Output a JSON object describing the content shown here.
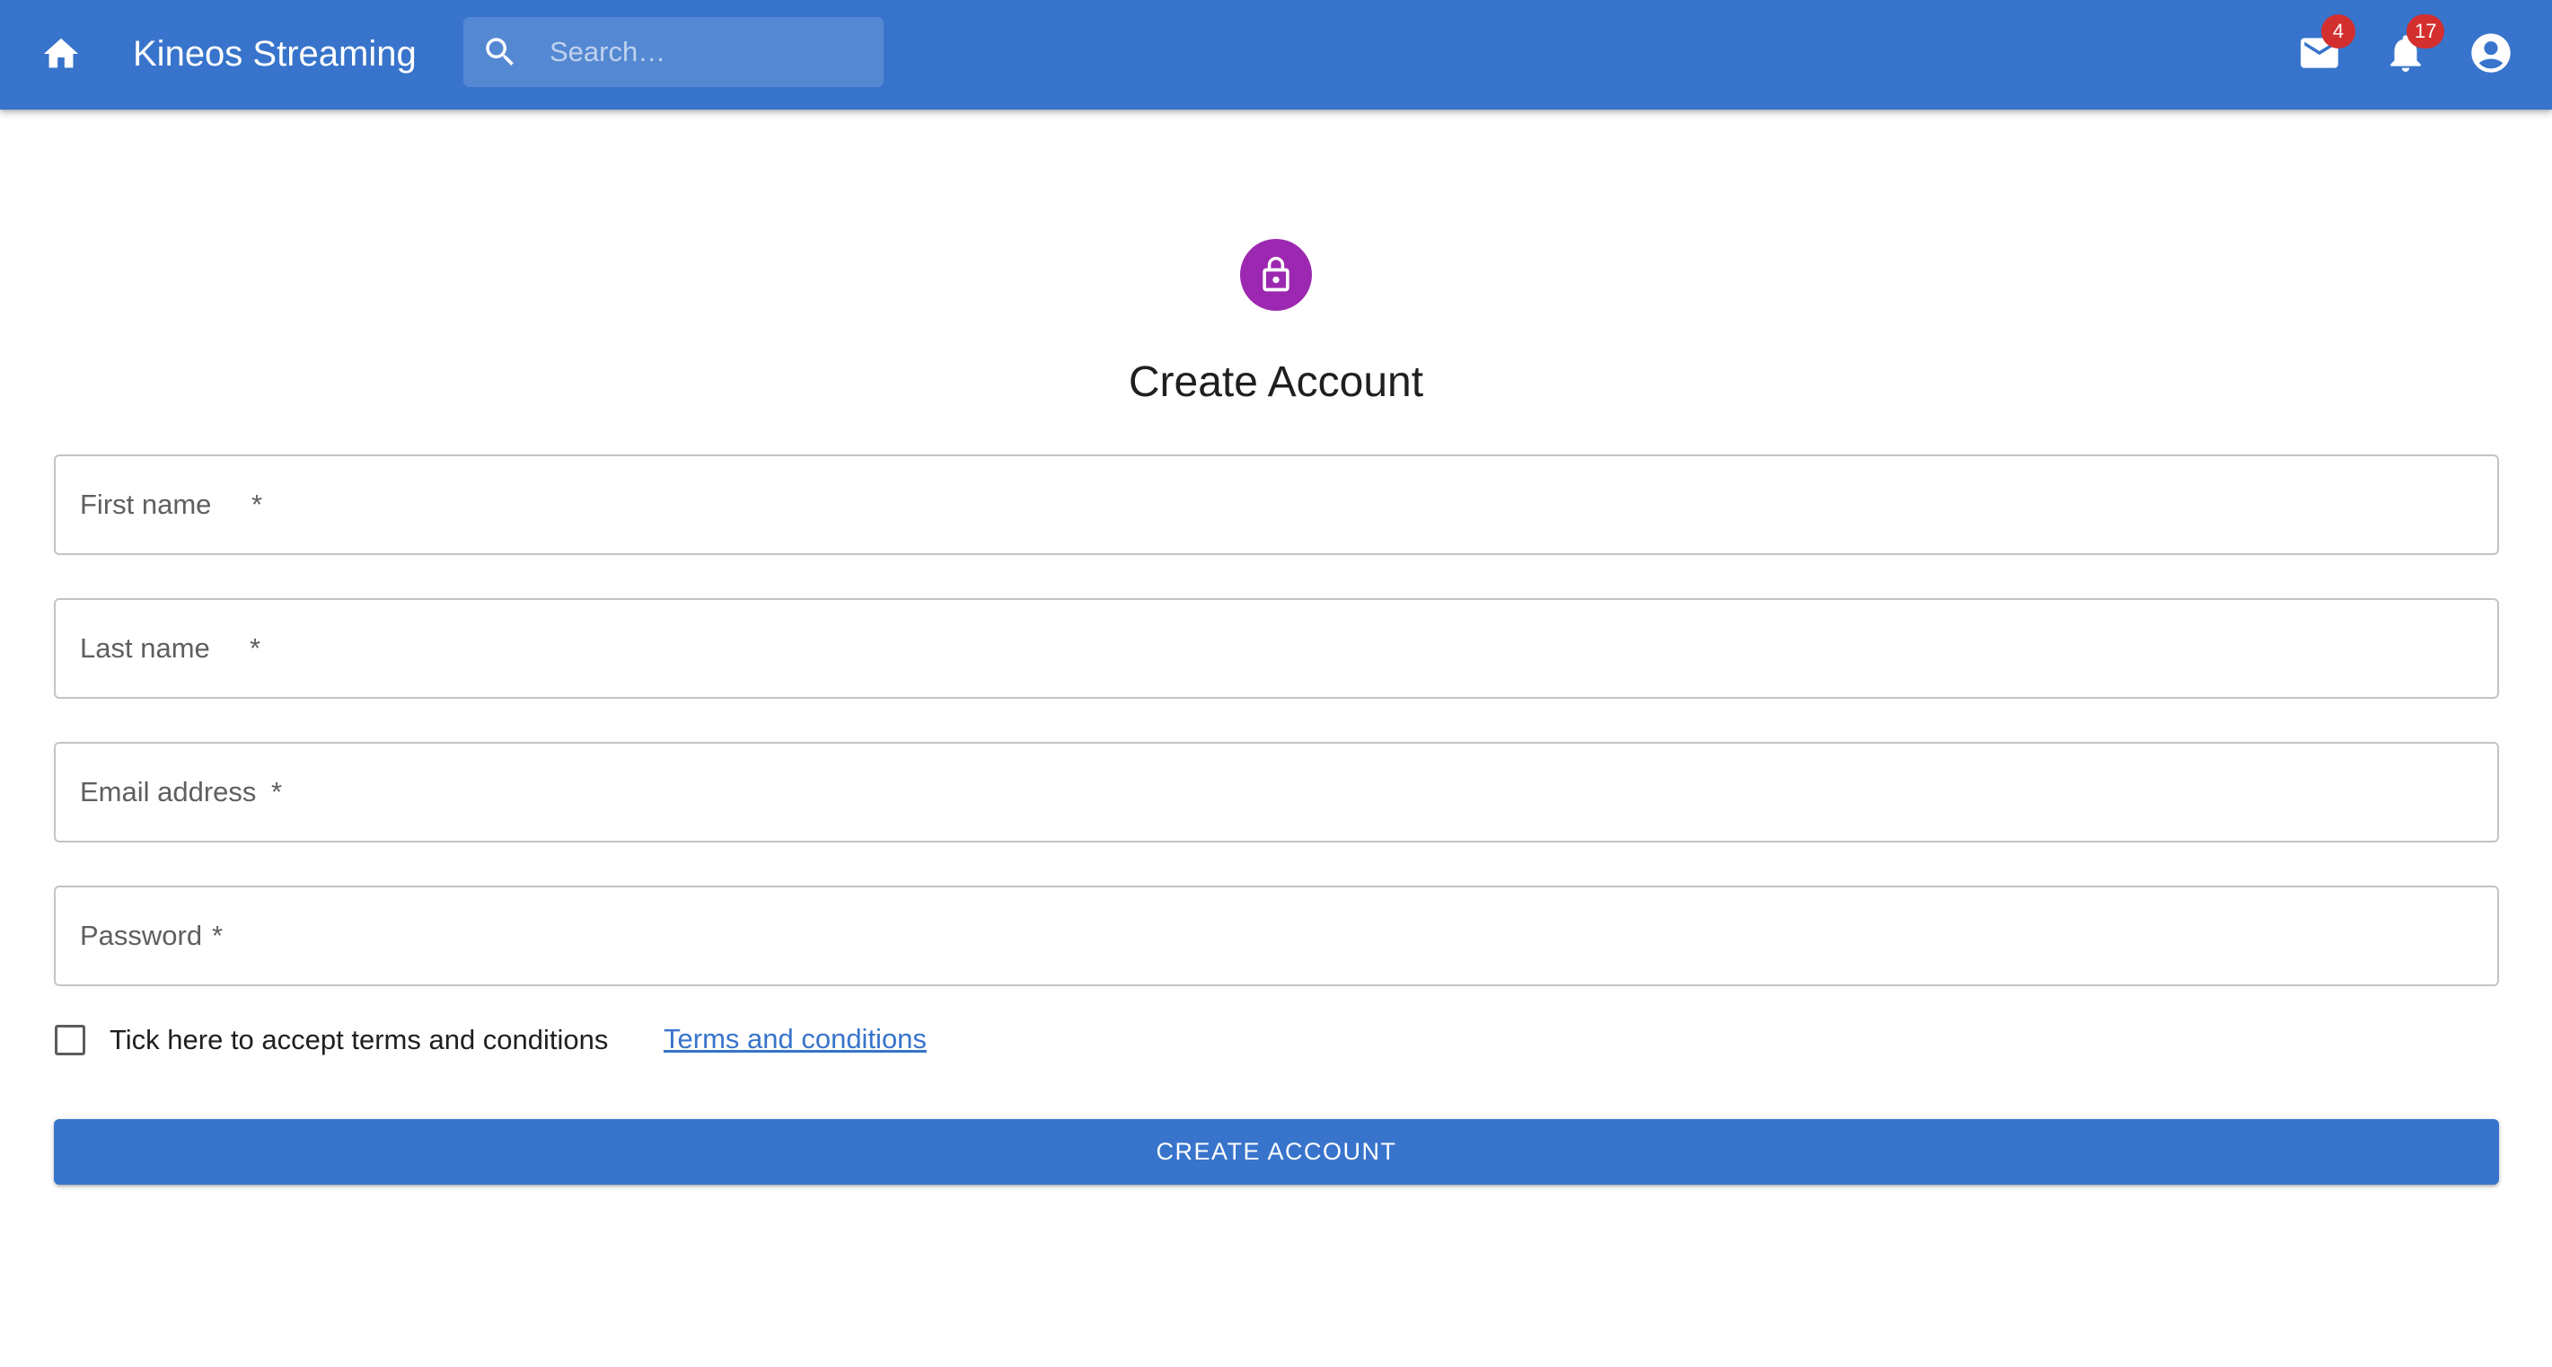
{
  "appbar": {
    "title": "Kineos Streaming",
    "background": "#3874cb",
    "home_icon": "home-icon",
    "search": {
      "placeholder": "Search…",
      "value": "",
      "icon": "search-icon"
    },
    "mail": {
      "icon": "mail-icon",
      "badge": "4"
    },
    "notifications": {
      "icon": "bell-icon",
      "badge": "17"
    },
    "account": {
      "icon": "account-circle-icon"
    },
    "badge_color": "#d32f2f"
  },
  "form": {
    "lock_icon": "lock-icon",
    "avatar_color": "#9c27b0",
    "title": "Create Account",
    "fields": [
      {
        "label": "First name",
        "required_mark": "*",
        "value": ""
      },
      {
        "label": "Last name",
        "required_mark": "*",
        "value": ""
      },
      {
        "label": "Email address",
        "required_mark": "*",
        "value": ""
      },
      {
        "label": "Password",
        "required_mark": "*",
        "value": ""
      }
    ],
    "terms": {
      "checked": false,
      "label": "Tick here to accept terms and conditions",
      "link_text": "Terms and conditions"
    },
    "submit_label": "CREATE ACCOUNT",
    "accent_color": "#3874cb"
  }
}
